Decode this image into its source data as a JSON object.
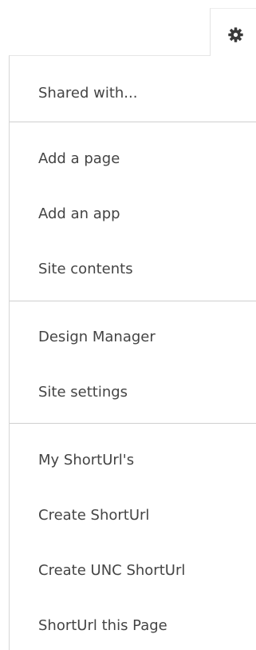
{
  "settings_button": {
    "icon": "gear-icon"
  },
  "menu": {
    "items": [
      "Shared with...",
      "Add a page",
      "Add an app",
      "Site contents",
      "Design Manager",
      "Site settings",
      "My ShortUrl's",
      "Create ShortUrl",
      "Create UNC ShortUrl",
      "ShortUrl this Page"
    ]
  }
}
